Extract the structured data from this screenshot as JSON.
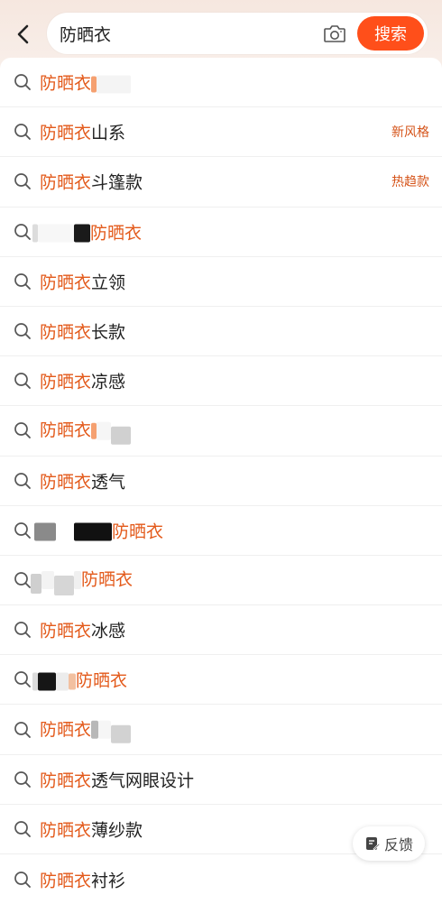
{
  "header": {
    "back_icon": "chevron-left-icon",
    "search_value": "防晒衣",
    "camera_icon": "camera-icon",
    "search_button": "搜索"
  },
  "suggestions": [
    {
      "keyword": "防晒衣",
      "suffix": "",
      "prefix": "",
      "tag": ""
    },
    {
      "keyword": "防晒衣",
      "suffix": "山系",
      "prefix": "",
      "tag": "新风格"
    },
    {
      "keyword": "防晒衣",
      "suffix": "斗篷款",
      "prefix": "",
      "tag": "热趋款"
    },
    {
      "keyword": "防晒衣",
      "suffix": "",
      "prefix": "",
      "tag": ""
    },
    {
      "keyword": "防晒衣",
      "suffix": "立领",
      "prefix": "",
      "tag": ""
    },
    {
      "keyword": "防晒衣",
      "suffix": "长款",
      "prefix": "",
      "tag": ""
    },
    {
      "keyword": "防晒衣",
      "suffix": "凉感",
      "prefix": "",
      "tag": ""
    },
    {
      "keyword": "防晒衣",
      "suffix": "",
      "prefix": "",
      "tag": ""
    },
    {
      "keyword": "防晒衣",
      "suffix": "透气",
      "prefix": "",
      "tag": ""
    },
    {
      "keyword": "防晒衣",
      "suffix": "",
      "prefix": "",
      "tag": ""
    },
    {
      "keyword": "防晒衣",
      "suffix": "",
      "prefix": "",
      "tag": ""
    },
    {
      "keyword": "防晒衣",
      "suffix": "冰感",
      "prefix": "",
      "tag": ""
    },
    {
      "keyword": "防晒衣",
      "suffix": "",
      "prefix": "",
      "tag": ""
    },
    {
      "keyword": "防晒衣",
      "suffix": "",
      "prefix": "",
      "tag": ""
    },
    {
      "keyword": "防晒衣",
      "suffix": "透气网眼设计",
      "prefix": "",
      "tag": ""
    },
    {
      "keyword": "防晒衣",
      "suffix": "薄纱款",
      "prefix": "",
      "tag": ""
    },
    {
      "keyword": "防晒衣",
      "suffix": "衬衫",
      "prefix": "",
      "tag": ""
    }
  ],
  "feedback": {
    "label": "反馈",
    "icon": "feedback-icon"
  },
  "colors": {
    "accent": "#ff4f1a",
    "highlight": "#e35a1b",
    "tag": "#d5541a"
  }
}
